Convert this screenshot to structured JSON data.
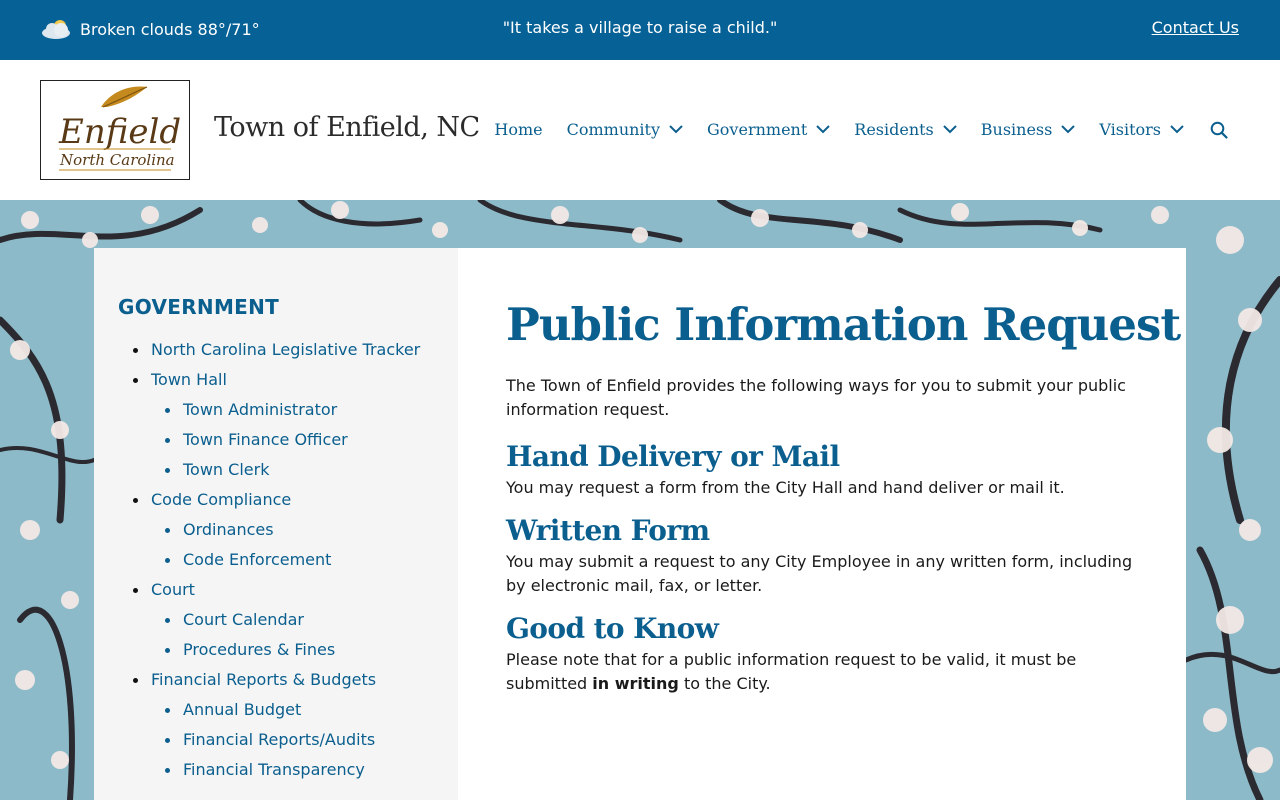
{
  "topbar": {
    "weather_icon": "cloud-sun-icon",
    "weather_text": "Broken clouds 88°/71°",
    "quote": "\"It takes a village to raise a child.\"",
    "contact_label": "Contact Us"
  },
  "header": {
    "logo": {
      "line1": "Enfield",
      "line2": "North Carolina"
    },
    "site_title": "Town of Enfield, NC",
    "nav": [
      {
        "label": "Home",
        "has_dropdown": false
      },
      {
        "label": "Community",
        "has_dropdown": true
      },
      {
        "label": "Government",
        "has_dropdown": true
      },
      {
        "label": "Residents",
        "has_dropdown": true
      },
      {
        "label": "Business",
        "has_dropdown": true
      },
      {
        "label": "Visitors",
        "has_dropdown": true
      }
    ],
    "search_icon": "search-icon"
  },
  "sidebar": {
    "heading": "GOVERNMENT",
    "items": [
      {
        "label": "North Carolina Legislative Tracker",
        "level": 1
      },
      {
        "label": "Town Hall",
        "level": 1
      },
      {
        "label": "Town Administrator",
        "level": 2
      },
      {
        "label": "Town Finance Officer",
        "level": 2
      },
      {
        "label": "Town Clerk",
        "level": 2
      },
      {
        "label": "Code Compliance",
        "level": 1
      },
      {
        "label": "Ordinances",
        "level": 2
      },
      {
        "label": "Code Enforcement",
        "level": 2
      },
      {
        "label": "Court",
        "level": 1
      },
      {
        "label": "Court Calendar",
        "level": 2
      },
      {
        "label": "Procedures & Fines",
        "level": 2
      },
      {
        "label": "Financial Reports & Budgets",
        "level": 1
      },
      {
        "label": "Annual Budget",
        "level": 2
      },
      {
        "label": "Financial Reports/Audits",
        "level": 2
      },
      {
        "label": "Financial Transparency",
        "level": 2
      }
    ]
  },
  "main": {
    "title": "Public Information Request",
    "intro": "The Town of Enfield provides the following ways for you to submit your public information request.",
    "sections": [
      {
        "heading": "Hand Delivery or Mail",
        "text": "You may request a form from the City Hall and hand deliver or mail it."
      },
      {
        "heading": "Written Form",
        "text": "You may submit a request to any City Employee in any written form, including by electronic mail, fax, or letter."
      },
      {
        "heading": "Good to Know",
        "text_before": "Please note that for a public information request to be valid, it must be submitted ",
        "text_bold": "in writing",
        "text_after": " to the City."
      }
    ]
  },
  "colors": {
    "brand_blue": "#066196",
    "link_blue": "#0b5f8f",
    "sidebar_bg": "#f5f5f5"
  }
}
